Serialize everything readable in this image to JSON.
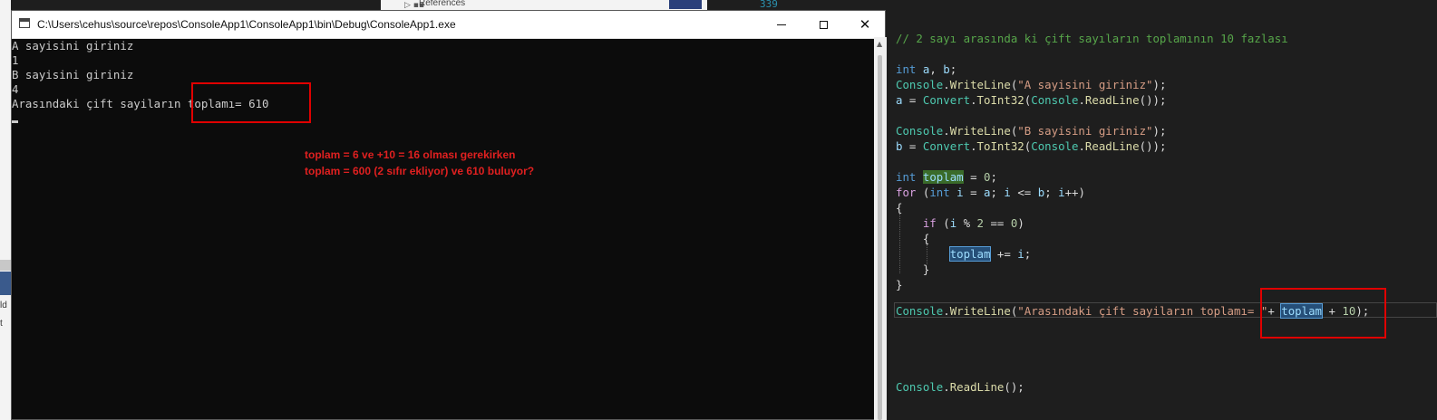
{
  "background": {
    "references_label": "References",
    "line_number": "339",
    "side_labels": [
      "ld",
      "t"
    ]
  },
  "console": {
    "title": "C:\\Users\\cehus\\source\\repos\\ConsoleApp1\\ConsoleApp1\\bin\\Debug\\ConsoleApp1.exe",
    "lines": [
      "A sayisini giriniz",
      "1",
      "B sayisini giriniz",
      "4",
      "Arasındaki çift sayiların toplamı= 610"
    ],
    "annotation": [
      "toplam = 6 ve +10 = 16 olması gerekirken",
      "toplam = 600 (2 sıfır ekliyor) ve 610 buluyor?"
    ]
  },
  "code": {
    "comment": "// 2 sayı arasında ki çift sayıların toplamının 10 fazlası",
    "str_a": "\"A sayisini giriniz\"",
    "str_b": "\"B sayisini giriniz\"",
    "str_result": "\"Arasındaki çift sayiların toplamı= \"",
    "kw_int": "int",
    "kw_for": "for",
    "kw_if": "if",
    "cls_console": "Console",
    "cls_convert": "Convert",
    "mth_writeline": "WriteLine",
    "mth_toint32": "ToInt32",
    "mth_readline": "ReadLine",
    "var_toplam": "toplam",
    "num_zero": "0",
    "num_two": "2",
    "num_ten": "10"
  },
  "colors": {
    "highlight_border": "#e00000",
    "console_bg": "#0c0c0c",
    "editor_bg": "#1e1e1e"
  }
}
